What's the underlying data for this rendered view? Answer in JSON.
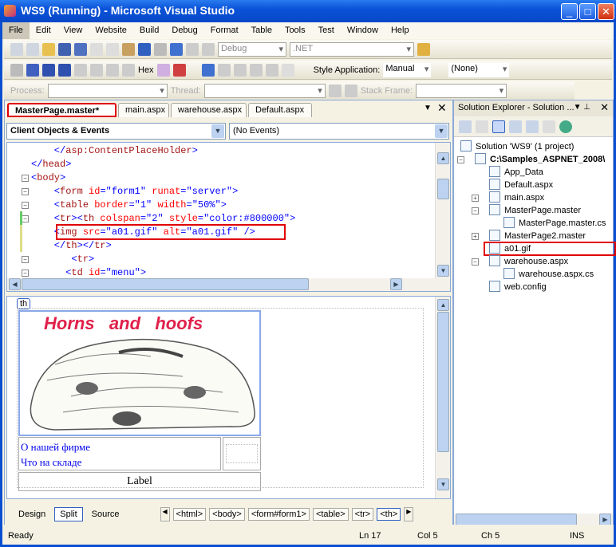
{
  "window": {
    "title": "WS9 (Running) - Microsoft Visual Studio",
    "controls": [
      "minimize",
      "maximize",
      "close"
    ]
  },
  "menu": [
    "File",
    "Edit",
    "View",
    "Website",
    "Build",
    "Debug",
    "Format",
    "Table",
    "Tools",
    "Test",
    "Window",
    "Help"
  ],
  "toolbar1": {
    "config": "Debug",
    "platform": ".NET"
  },
  "toolbar2": {
    "hex": "Hex",
    "style_label": "Style Application:",
    "style_value": "Manual",
    "target_rule": "(None)"
  },
  "toolbar3": {
    "process": "Process:",
    "thread": "Thread:",
    "stack": "Stack Frame:"
  },
  "tabs": [
    "MasterPage.master*",
    "main.aspx",
    "warehouse.aspx",
    "Default.aspx"
  ],
  "editor": {
    "objects": "Client Objects & Events",
    "events": "(No Events)"
  },
  "code_lines": [
    [
      [
        "tag",
        "    </"
      ],
      [
        "el",
        "asp:ContentPlaceHolder"
      ],
      [
        "tag",
        ">"
      ]
    ],
    [
      [
        "tag",
        "</"
      ],
      [
        "el",
        "head"
      ],
      [
        "tag",
        ">"
      ]
    ],
    [
      [
        "tag",
        "<"
      ],
      [
        "el",
        "body"
      ],
      [
        "tag",
        ">"
      ]
    ],
    [
      [
        "tag",
        "    <"
      ],
      [
        "el",
        "form"
      ],
      [
        "at",
        " id"
      ],
      [
        "tag",
        "="
      ],
      [
        "av",
        "\"form1\""
      ],
      [
        "at",
        " runat"
      ],
      [
        "tag",
        "="
      ],
      [
        "av",
        "\"server\""
      ],
      [
        "tag",
        ">"
      ]
    ],
    [
      [
        "tag",
        "    <"
      ],
      [
        "el",
        "table"
      ],
      [
        "at",
        " border"
      ],
      [
        "tag",
        "="
      ],
      [
        "av",
        "\"1\""
      ],
      [
        "at",
        " width"
      ],
      [
        "tag",
        "="
      ],
      [
        "av",
        "\"50%\""
      ],
      [
        "tag",
        ">"
      ]
    ],
    [
      [
        "tag",
        "    <"
      ],
      [
        "el",
        "tr"
      ],
      [
        "tag",
        "><"
      ],
      [
        "el",
        "th"
      ],
      [
        "at",
        " colspan"
      ],
      [
        "tag",
        "="
      ],
      [
        "av",
        "\"2\""
      ],
      [
        "at",
        " style"
      ],
      [
        "tag",
        "="
      ],
      [
        "av",
        "\"color:#800000\""
      ],
      [
        "tag",
        ">"
      ]
    ],
    [
      [
        "tag",
        "    <"
      ],
      [
        "el",
        "img"
      ],
      [
        "at",
        " src"
      ],
      [
        "tag",
        "="
      ],
      [
        "av",
        "\"a01.gif\""
      ],
      [
        "at",
        " alt"
      ],
      [
        "tag",
        "="
      ],
      [
        "av",
        "\"a01.gif\""
      ],
      [
        "tag",
        " />"
      ]
    ],
    [
      [
        "tag",
        "    </"
      ],
      [
        "el",
        "th"
      ],
      [
        "tag",
        "></"
      ],
      [
        "el",
        "tr"
      ],
      [
        "tag",
        ">"
      ]
    ],
    [
      [
        "tag",
        "       <"
      ],
      [
        "el",
        "tr"
      ],
      [
        "tag",
        ">"
      ]
    ],
    [
      [
        "tag",
        "      <"
      ],
      [
        "el",
        "td"
      ],
      [
        "at",
        " id"
      ],
      [
        "tag",
        "="
      ],
      [
        "av",
        "\"menu\""
      ],
      [
        "tag",
        ">"
      ]
    ]
  ],
  "design": {
    "tag_label": "th",
    "image_text": "Horns   and   hoofs",
    "link1": "О нашей фирме",
    "link2": "Что на складе",
    "label": "Label"
  },
  "view_tabs": [
    "Design",
    "Split",
    "Source"
  ],
  "breadcrumbs": [
    "<html>",
    "<body>",
    "<form#form1>",
    "<table>",
    "<tr>",
    "<th>"
  ],
  "solution_explorer": {
    "title": "Solution Explorer - Solution ...",
    "items": [
      {
        "label": "Solution 'WS9' (1 project)",
        "level": 0
      },
      {
        "label": "C:\\Samples_ASPNET_2008\\",
        "level": 1,
        "bold": true,
        "expand": "-"
      },
      {
        "label": "App_Data",
        "level": 2
      },
      {
        "label": "Default.aspx",
        "level": 2
      },
      {
        "label": "main.aspx",
        "level": 2,
        "expand": "+"
      },
      {
        "label": "MasterPage.master",
        "level": 2,
        "expand": "-"
      },
      {
        "label": "MasterPage.master.cs",
        "level": 3
      },
      {
        "label": "MasterPage2.master",
        "level": 2,
        "expand": "+"
      },
      {
        "label": "a01.gif",
        "level": 2,
        "highlight": true
      },
      {
        "label": "warehouse.aspx",
        "level": 2,
        "expand": "-"
      },
      {
        "label": "warehouse.aspx.cs",
        "level": 3
      },
      {
        "label": "web.config",
        "level": 2
      }
    ]
  },
  "status": {
    "text": "Ready",
    "ln": "Ln 17",
    "col": "Col 5",
    "ch": "Ch 5",
    "mode": "INS"
  },
  "colors": {
    "highlight": "#e00000",
    "link": "#0000ee",
    "banner": "#e0204a"
  }
}
